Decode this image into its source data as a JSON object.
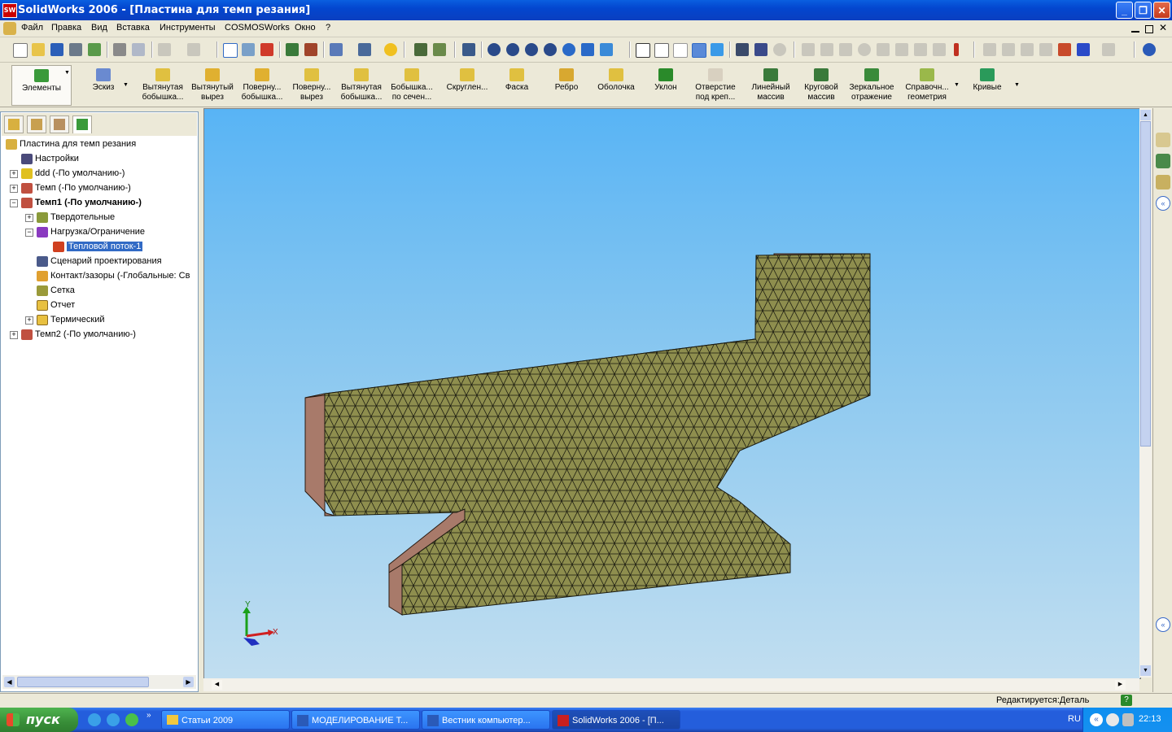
{
  "window": {
    "title": "SolidWorks 2006 - [Пластина для темп резания]",
    "app_icon_text": "SW",
    "buttons": [
      "_",
      "❐",
      "✕"
    ]
  },
  "menu": {
    "items": [
      "Файл",
      "Правка",
      "Вид",
      "Вставка",
      "Инструменты",
      "COSMOSWorks",
      "Окно",
      "?"
    ]
  },
  "command_manager": {
    "items": [
      {
        "label": "Элементы"
      },
      {
        "label": "Эскиз"
      },
      {
        "label": "Вытянутая\nбобышка..."
      },
      {
        "label": "Вытянутый\nвырез"
      },
      {
        "label": "Поверну...\nбобышка..."
      },
      {
        "label": "Поверну...\nвырез"
      },
      {
        "label": "Вытянутая\nбобышка..."
      },
      {
        "label": "Бобышка...\nпо сечен..."
      },
      {
        "label": "Скруглен..."
      },
      {
        "label": "Фаска"
      },
      {
        "label": "Ребро"
      },
      {
        "label": "Оболочка"
      },
      {
        "label": "Уклон"
      },
      {
        "label": "Отверстие\nпод креп..."
      },
      {
        "label": "Линейный\nмассив"
      },
      {
        "label": "Круговой\nмассив"
      },
      {
        "label": "Зеркальное\nотражение"
      },
      {
        "label": "Справочн...\nгеометрия"
      },
      {
        "label": "Кривые"
      }
    ]
  },
  "tree": {
    "root": "Пластина для темп резания",
    "items": [
      {
        "label": "Настройки",
        "level": 1
      },
      {
        "label": "ddd (-По умолчанию-)",
        "level": 1
      },
      {
        "label": "Темп (-По умолчанию-)",
        "level": 1
      },
      {
        "label": "Темп1 (-По умолчанию-)",
        "level": 1
      },
      {
        "label": "Твердотельные",
        "level": 2
      },
      {
        "label": "Нагрузка/Ограничение",
        "level": 2
      },
      {
        "label": "Тепловой поток-1",
        "level": 3
      },
      {
        "label": "Сценарий проектирования",
        "level": 2
      },
      {
        "label": "Контакт/зазоры (-Глобальные: Св",
        "level": 2
      },
      {
        "label": "Сетка",
        "level": 2
      },
      {
        "label": "Отчет",
        "level": 2
      },
      {
        "label": "Термический",
        "level": 2
      },
      {
        "label": "Темп2 (-По умолчанию-)",
        "level": 1
      }
    ]
  },
  "viewport": {
    "triad": {
      "x_label": "X",
      "y_label": "Y"
    },
    "colors": {
      "mesh_face": "#8e8e4e",
      "mesh_side": "#a87a6a",
      "mesh_line": "#1a1a10"
    }
  },
  "status": {
    "text": "Редактируется:Деталь",
    "help": "?"
  },
  "taskbar": {
    "start": "пуск",
    "tasks": [
      "Статьи 2009",
      "МОДЕЛИРОВАНИЕ Т...",
      "Вестник компьютер...",
      "SolidWorks 2006 - [П..."
    ],
    "lang": "RU",
    "time": "22:13"
  }
}
